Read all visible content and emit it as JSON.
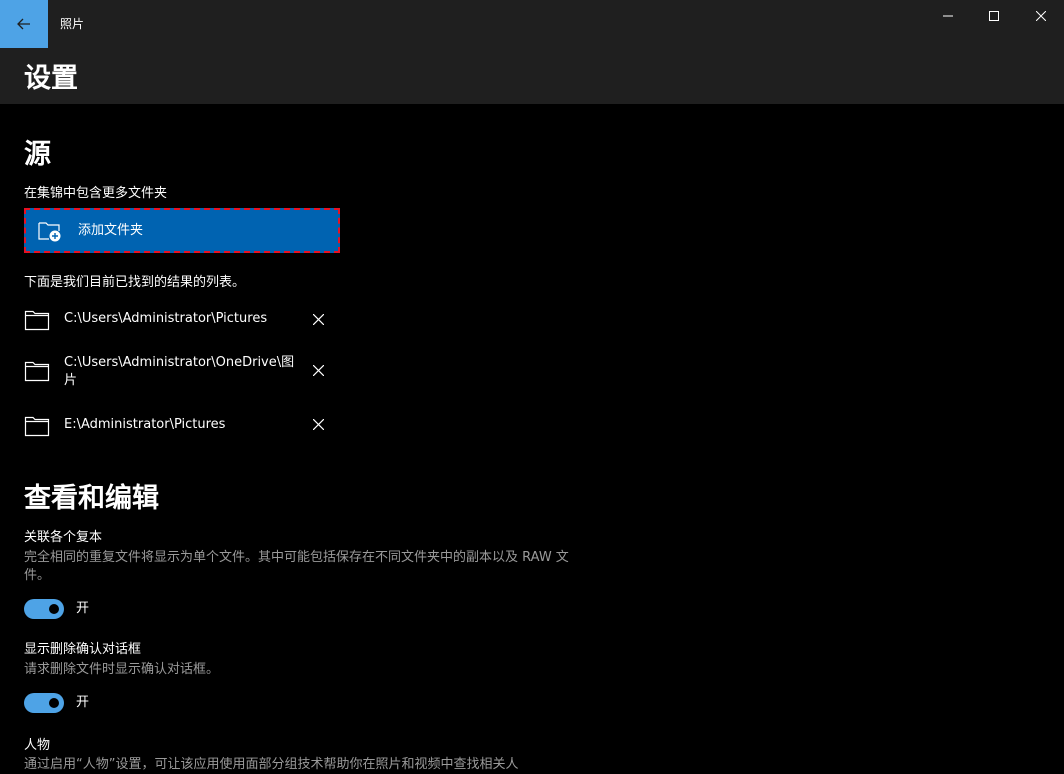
{
  "window": {
    "app_title": "照片",
    "icons": {
      "back": "back-arrow-icon",
      "minimize": "minimize-icon",
      "maximize": "maximize-icon",
      "close": "close-icon"
    }
  },
  "colors": {
    "accent": "#4ea3e6",
    "button_blue": "#0063b1",
    "focus_outline": "#e81123",
    "background": "#000000",
    "header": "#1f1f1f",
    "secondary_text": "#9a9a9a"
  },
  "page": {
    "title": "设置"
  },
  "sources": {
    "title": "源",
    "include_label": "在集锦中包含更多文件夹",
    "add_folder_label": "添加文件夹",
    "add_folder_icon": "add-folder-icon",
    "list_caption": "下面是我们目前已找到的结果的列表。",
    "folders": [
      {
        "path": "C:\\Users\\Administrator\\Pictures"
      },
      {
        "path": "C:\\Users\\Administrator\\OneDrive\\图片"
      },
      {
        "path": "E:\\Administrator\\Pictures"
      }
    ]
  },
  "view_edit": {
    "title": "查看和编辑",
    "link_copies": {
      "label": "关联各个复本",
      "description": "完全相同的重复文件将显示为单个文件。其中可能包括保存在不同文件夹中的副本以及 RAW 文件。",
      "state_label": "开",
      "on": true
    },
    "delete_confirm": {
      "label": "显示删除确认对话框",
      "description": "请求删除文件时显示确认对话框。",
      "state_label": "开",
      "on": true
    },
    "people": {
      "label": "人物",
      "description": "通过启用“人物”设置，可让该应用使用面部分组技术帮助你在照片和视频中查找相关人"
    }
  }
}
